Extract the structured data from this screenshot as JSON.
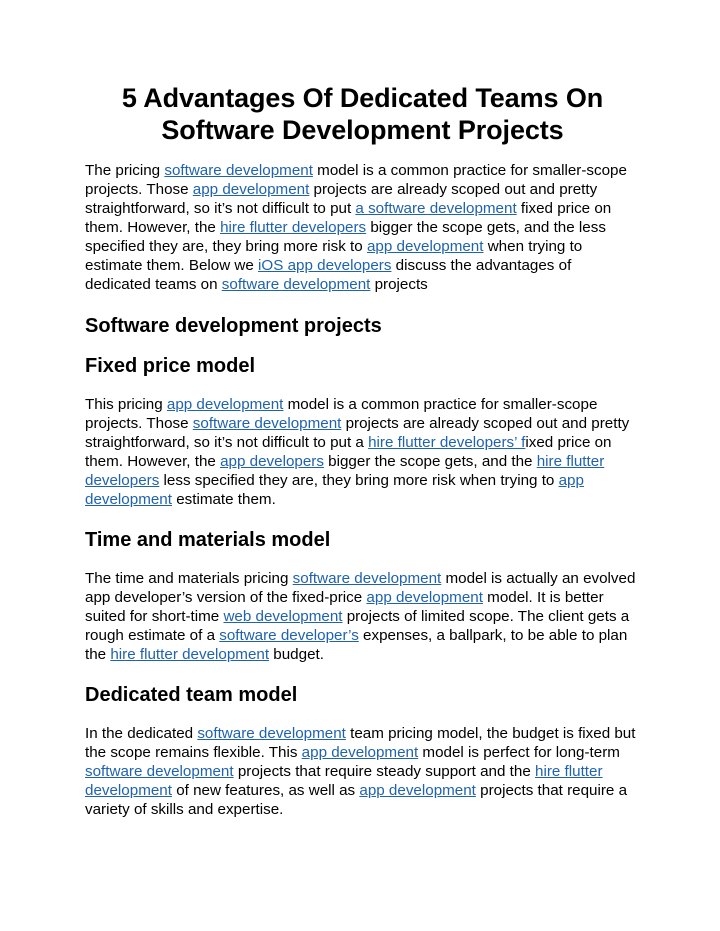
{
  "document": {
    "title_line1": "5 Advantages Of Dedicated Teams On",
    "title_line2": "Software Development Projects",
    "link_color": "#1f62ae",
    "intro": {
      "t0": "The pricing ",
      "l0": "software development",
      "t1": " model is a common practice for smaller-scope projects. Those ",
      "l1": "app development",
      "t2": " projects are already scoped out and pretty straightforward, so it’s not difficult to put ",
      "l2": "a software development",
      "t3": " fixed price on them. However, the ",
      "l3": "hire flutter developers",
      "t4": " bigger the scope gets, and the less specified they are, they bring more risk to ",
      "l4": "app development",
      "t5": " when trying to estimate them. Below we ",
      "l5": "iOS app developers",
      "t6": " discuss the advantages of dedicated teams on ",
      "l6": "software development",
      "t7": " projects"
    },
    "section_software": {
      "heading": "Software development projects"
    },
    "section_fixed": {
      "heading": "Fixed price model",
      "t0": "This pricing ",
      "l0": "app development",
      "t1": " model is a common practice for smaller-scope projects. Those ",
      "l1": "software development",
      "t2": " projects are already scoped out and pretty straightforward, so it’s not difficult to put a ",
      "l2": "hire flutter developers’ f",
      "t3": "ixed price on them. However, the ",
      "l3": "app developers",
      "t4": " bigger the scope gets, and the ",
      "l4": "hire flutter developers",
      "t5": " less specified they are, they bring more risk when trying to ",
      "l5": "app development",
      "t6": " estimate them."
    },
    "section_time": {
      "heading": "Time and materials model",
      "t0": "The time and materials pricing ",
      "l0": "software development",
      "t1": " model is actually an evolved app developer’s version of the fixed-price ",
      "l1": "app development",
      "t2": " model. It is better suited for short-time ",
      "l2": "web development",
      "t3": " projects of limited scope. The client gets a rough estimate of a ",
      "l3": "software developer’s",
      "t4": " expenses, a ballpark, to be able to plan the ",
      "l4": "hire flutter development",
      "t5": " budget."
    },
    "section_dedicated": {
      "heading": "Dedicated team model",
      "t0": "In the dedicated ",
      "l0": "software development",
      "t1": " team pricing model, the budget is fixed but the scope remains flexible. This ",
      "l1": "app development",
      "t2": " model is perfect for long-term ",
      "l2": "software development",
      "t3": " projects that require steady support and the ",
      "l3": "hire flutter development",
      "t4": " of new features, as well as ",
      "l4": "app development",
      "t5": " projects that require a variety of skills and expertise."
    }
  }
}
